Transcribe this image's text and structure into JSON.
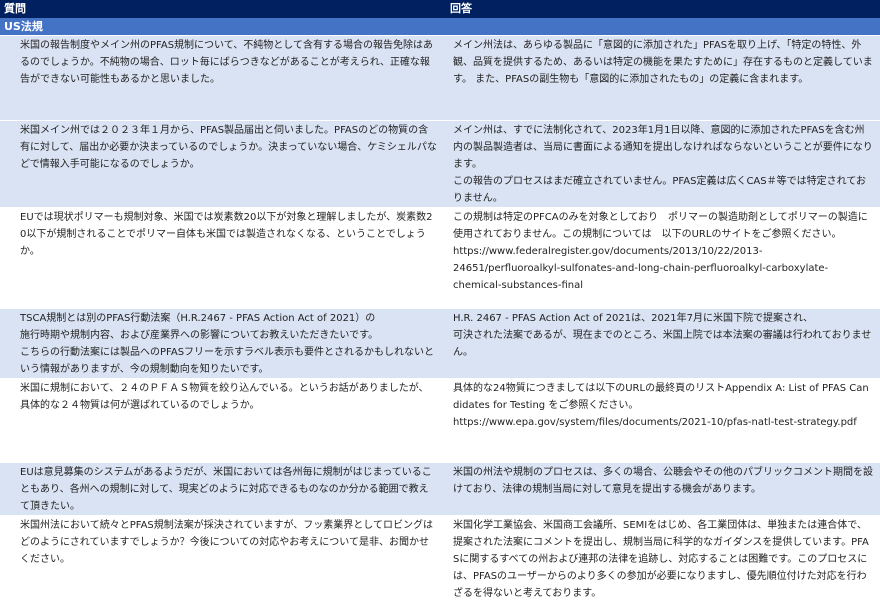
{
  "header": {
    "question_label": "質問",
    "answer_label": "回答"
  },
  "section": {
    "label": "US法規"
  },
  "rows": [
    {
      "question": "米国の報告制度やメイン州のPFAS規制について、不純物として含有する場合の報告免除はあるのでしょうか。不純物の場合、ロット毎にばらつきなどがあることが考えられ、正確な報告ができない可能性もあるかと思いました。",
      "answer": "メイン州法は、あらゆる製品に「意図的に添加された」PFASを取り上げ、「特定の特性、外観、品質を提供するため、あるいは特定の機能を果たすために」存在するものと定義しています。 また、PFASの副生物も「意図的に添加されたもの」の定義に含まれます。"
    },
    {
      "question": "米国メイン州では２０２３年１月から、PFAS製品届出と伺いました。PFASのどの物質の含有に対して、届出か必要か決まっているのでしょうか。決まっていない場合、ケミシェルパなどで情報入手可能になるのでしょうか。",
      "answer": "メイン州は、すでに法制化されて、2023年1月1日以降、意図的に添加されたPFASを含む州内の製品製造者は、当局に書面による通知を提出しなければならないということが要件になります。",
      "answer_2": "この報告のプロセスはまだ確立されていません。PFAS定義は広くCAS＃等では特定されておりません。"
    },
    {
      "question": "EUでは現状ポリマーも規制対象、米国では炭素数20以下が対象と理解しましたが、炭素数20以下が規制されることでポリマー自体も米国では製造されなくなる、ということでしょうか。",
      "answer": "この規制は特定のPFCAのみを対象としており　ポリマーの製造助剤としてポリマーの製造に使用されておりません。この規制については　以下のURLのサイトをご参照ください。",
      "answer_url_1": "https://www.federalregister.gov/documents/2013/10/22/2013-",
      "answer_url_2": "24651/perfluoroalkyl-sulfonates-and-long-chain-perfluoroalkyl-carboxylate-",
      "answer_url_3": "chemical-substances-final"
    },
    {
      "question_1": "TSCA規制とは別のPFAS行動法案（H.R.2467 - PFAS Action Act of 2021）の",
      "question_2": "施行時期や規制内容、および産業界への影響についてお教えいただきたいです。",
      "question_3": "こちらの行動法案には製品へのPFASフリーを示すラベル表示も要件とされるかもしれないという情報がありますが、今の規制動向を知りたいです。",
      "answer_1": "H.R. 2467 - PFAS Action Act of 2021は、2021年7月に米国下院で提案され、",
      "answer_2": "可決された法案であるが、現在までのところ、米国上院では本法案の審議は行われておりません。"
    },
    {
      "question": "米国に規制において、２４のＰＦＡＳ物質を絞り込んでいる。というお話がありましたが、具体的な２４物質は何が選ばれているのでしょうか。",
      "answer": "具体的な24物質につきましては以下のURLの最終頁のリストAppendix A: List of PFAS Candidates for Testing をご参照ください。",
      "answer_url": "https://www.epa.gov/system/files/documents/2021-10/pfas-natl-test-strategy.pdf"
    },
    {
      "question": "EUは意見募集のシステムがあるようだが、米国においては各州毎に規制がはじまっていることもあり、各州への規制に対して、現実どのように対応できるものなのか分かる範囲で教えて頂きたい。",
      "answer": "米国の州法や規制のプロセスは、多くの場合、公聴会やその他のパブリックコメント期間を設けており、法律の規制当局に対して意見を提出する機会があります。"
    },
    {
      "question": "米国州法において続々とPFAS規制法案が採決されていますが、フッ素業界としてロビングはどのようにされていますでしょうか？今後についての対応やお考えについて是非、お聞かせください。",
      "answer": "米国化学工業協会、米国商工会議所、SEMIをはじめ、各工業団体は、単独または連合体で、提案された法案にコメントを提出し、規制当局に科学的なガイダンスを提供しています。PFASに関するすべての州および連邦の法律を追跡し、対応することは困難です。このプロセスには、PFASのユーザーからのより多くの参加が必要になりますし、優先順位付けた対応を行わざるを得ないと考えております。"
    }
  ]
}
